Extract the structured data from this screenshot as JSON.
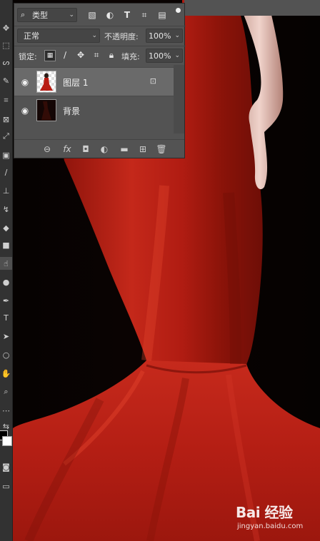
{
  "layers_panel": {
    "filter": {
      "icon": "search-icon",
      "value": "类型"
    },
    "filter_icons": [
      "image-filter-icon",
      "adjustment-filter-icon",
      "type-filter-icon",
      "shape-filter-icon",
      "smart-object-filter-icon"
    ],
    "blend_mode": "正常",
    "opacity_label": "不透明度:",
    "opacity_value": "100%",
    "lock_label": "锁定:",
    "lock_icons": [
      "lock-transparent-icon",
      "lock-paint-icon",
      "lock-move-icon",
      "lock-artboard-icon",
      "lock-all-icon"
    ],
    "fill_label": "填充:",
    "fill_value": "100%",
    "layers": [
      {
        "name": "图层 1",
        "visible": true,
        "selected": true,
        "locked": false
      },
      {
        "name": "背景",
        "visible": true,
        "selected": false,
        "locked": false
      }
    ],
    "footer_icons": [
      "link-layers-icon",
      "fx-icon",
      "add-mask-icon",
      "adjustment-layer-icon",
      "new-group-icon",
      "new-layer-icon",
      "delete-layer-icon"
    ],
    "fx_label": "fx"
  },
  "toolbar": {
    "tools": [
      "move-tool-icon",
      "marquee-tool-icon",
      "lasso-tool-icon",
      "quick-select-tool-icon",
      "crop-tool-icon",
      "frame-tool-icon",
      "eyedropper-tool-icon",
      "healing-tool-icon",
      "brush-tool-icon",
      "stamp-tool-icon",
      "history-brush-tool-icon",
      "eraser-tool-icon",
      "gradient-tool-icon",
      "smudge-tool-icon",
      "dodge-tool-icon",
      "pen-tool-icon",
      "type-tool-icon",
      "path-select-tool-icon",
      "ellipse-tool-icon",
      "hand-tool-icon",
      "zoom-tool-icon",
      "more-tools-icon",
      "swap-colors-icon"
    ],
    "type_tool_glyph": "T",
    "foreground_color": "#000000",
    "background_color": "#ffffff"
  },
  "watermark": {
    "logo": "Bai 经验",
    "url": "jingyan.baidu.com"
  },
  "colors": {
    "dress_red": "#b81d14",
    "panel_bg": "#535353",
    "selected_layer": "#6a6a6a"
  }
}
